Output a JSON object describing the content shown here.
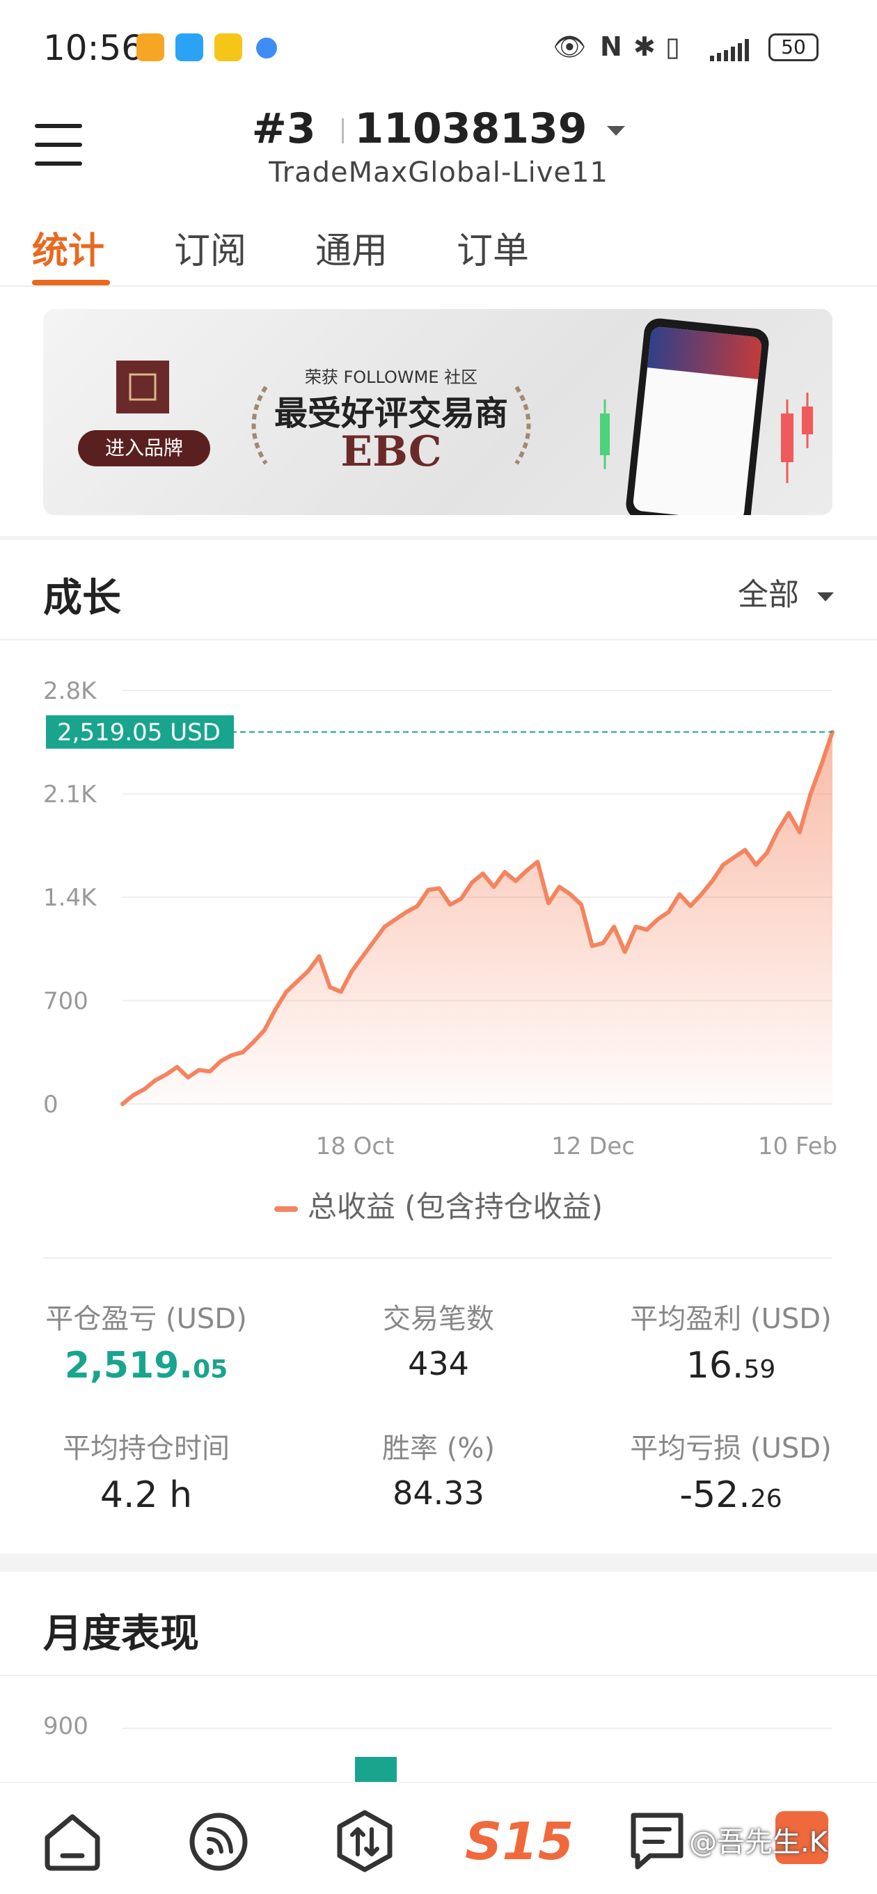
{
  "status_bar": {
    "time": "10:56",
    "battery": "50"
  },
  "header": {
    "account_prefix": "#3",
    "account_number": "11038139",
    "server": "TradeMaxGlobal-Live11"
  },
  "tabs": [
    {
      "label": "统计",
      "active": true
    },
    {
      "label": "订阅",
      "active": false
    },
    {
      "label": "通用",
      "active": false
    },
    {
      "label": "订单",
      "active": false
    }
  ],
  "banner": {
    "tagline": "荣获 FOLLOWME 社区",
    "headline": "最受好评交易商",
    "brand": "EBC",
    "cta": "进入品牌"
  },
  "growth": {
    "title": "成长",
    "range": "全部",
    "current_label": "2,519.05 USD",
    "legend": "总收益 (包含持仓收益)"
  },
  "chart_data": {
    "type": "area",
    "y_ticks": [
      "0",
      "700",
      "1.4K",
      "2.1K",
      "2.8K"
    ],
    "x_ticks": [
      "18 Oct",
      "12 Dec",
      "10 Feb"
    ],
    "ylim": [
      0,
      2800
    ],
    "reference_value": 2519.05,
    "series": [
      {
        "name": "总收益 (包含持仓收益)",
        "color": "#f4845f",
        "values": [
          0,
          60,
          100,
          160,
          200,
          250,
          180,
          230,
          220,
          290,
          330,
          350,
          420,
          500,
          640,
          760,
          830,
          900,
          1000,
          790,
          760,
          900,
          1000,
          1100,
          1200,
          1250,
          1300,
          1340,
          1450,
          1460,
          1350,
          1390,
          1500,
          1560,
          1470,
          1570,
          1510,
          1580,
          1640,
          1360,
          1470,
          1420,
          1350,
          1070,
          1090,
          1200,
          1030,
          1200,
          1180,
          1250,
          1300,
          1420,
          1340,
          1420,
          1510,
          1620,
          1670,
          1720,
          1620,
          1700,
          1850,
          1970,
          1840,
          2100,
          2300,
          2519
        ]
      }
    ]
  },
  "stats": {
    "closed_pnl": {
      "label": "平仓盈亏 (USD)",
      "main": "2,519.",
      "decimal": "05"
    },
    "trades": {
      "label": "交易笔数",
      "value": "434"
    },
    "avg_profit": {
      "label": "平均盈利 (USD)",
      "main": "16.",
      "decimal": "59"
    },
    "avg_hold": {
      "label": "平均持仓时间",
      "value": "4.2 h"
    },
    "win_rate": {
      "label": "胜率 (%)",
      "value": "84.33"
    },
    "avg_loss": {
      "label": "平均亏损 (USD)",
      "main": "-52.",
      "decimal": "26"
    }
  },
  "monthly": {
    "title": "月度表现",
    "y_tick": "900"
  },
  "bottom_nav": {
    "center_label": "S15",
    "watermark": "@吾先生.K"
  },
  "colors": {
    "accent": "#e9691f",
    "profit_green": "#19a48d",
    "chart_line": "#f4845f"
  }
}
